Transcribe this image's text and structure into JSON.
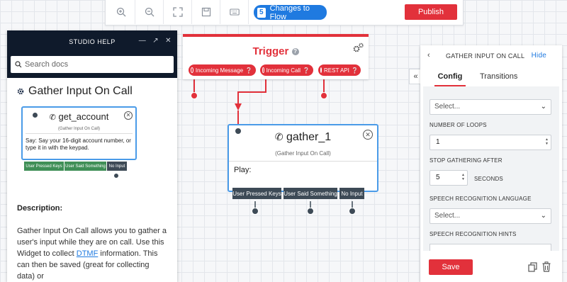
{
  "toolbar": {
    "changes_count": "5",
    "changes_label": "Changes to Flow",
    "publish_label": "Publish"
  },
  "help": {
    "header_title": "STUDIO HELP",
    "search_placeholder": "Search docs",
    "title": "Gather Input On Call",
    "example_widget": {
      "name": "get_account",
      "type": "(Gather Input On Call)",
      "say_text": "Say: Say your 16-digit account number, or type it in with the keypad.",
      "outputs": [
        "User Pressed Keys",
        "User Said Something",
        "No Input"
      ]
    },
    "description_heading": "Description:",
    "description_before_link": "Gather Input On Call allows you to gather a user's input while they are on call. Use this Widget to collect ",
    "description_link": "DTMF",
    "description_after_link": " information. This can then be saved (great for collecting data) or"
  },
  "trigger": {
    "title": "Trigger",
    "pills": [
      "Incoming Message",
      "Incoming Call",
      "REST API"
    ]
  },
  "gather": {
    "name": "gather_1",
    "type": "(Gather Input On Call)",
    "play_label": "Play:",
    "outputs": [
      "User Pressed Keys",
      "User Said Something",
      "No Input"
    ]
  },
  "panel": {
    "title": "GATHER INPUT ON CALL",
    "hide_label": "Hide",
    "tabs": [
      "Config",
      "Transitions"
    ],
    "active_tab": "Config",
    "select1_value": "Select...",
    "loops_label": "NUMBER OF LOOPS",
    "loops_value": "1",
    "stop_label": "STOP GATHERING AFTER",
    "stop_value": "5",
    "seconds_label": "SECONDS",
    "speech_lang_label": "SPEECH RECOGNITION LANGUAGE",
    "speech_lang_value": "Select...",
    "speech_hints_label": "SPEECH RECOGNITION HINTS",
    "save_label": "Save"
  },
  "colors": {
    "accent_red": "#e2313b",
    "accent_blue": "#1f7ae0",
    "widget_border": "#4a9be8",
    "dark_header": "#0f1a2b"
  },
  "icons": [
    "zoom-in-icon",
    "zoom-out-icon",
    "fullscreen-icon",
    "save-icon",
    "keyboard-icon",
    "search-icon",
    "gear-icon",
    "phone-icon",
    "close-icon",
    "chevron-left-icon",
    "double-chevron-left-icon",
    "copy-icon",
    "trash-icon"
  ]
}
